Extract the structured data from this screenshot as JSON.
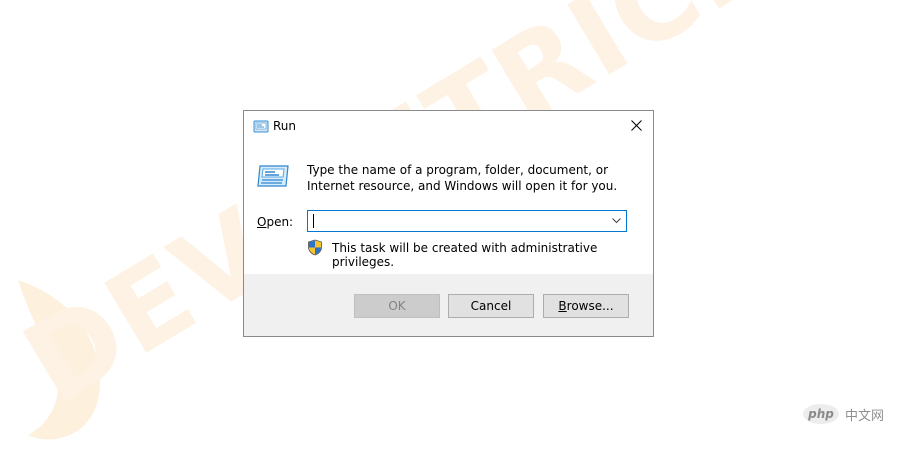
{
  "window": {
    "title": "Run",
    "description": "Type the name of a program, folder, document, or Internet resource, and Windows will open it for you.",
    "open_label_prefix": "O",
    "open_label_rest": "pen:",
    "open_value": "",
    "admin_note": "This task will be created with administrative privileges.",
    "buttons": {
      "ok": "OK",
      "cancel": "Cancel",
      "browse_prefix": "B",
      "browse_rest": "rowse..."
    }
  },
  "watermark": {
    "text": "DEVICETRICKS",
    "badge_text": "php",
    "badge_suffix": "中文网"
  },
  "icons": {
    "title": "run-icon",
    "body": "run-icon",
    "shield": "uac-shield-icon",
    "close": "close-icon",
    "dropdown": "chevron-down-icon"
  },
  "colors": {
    "accent": "#0078d7",
    "footer": "#f0f0f0",
    "watermark": "#fdf2e3"
  }
}
